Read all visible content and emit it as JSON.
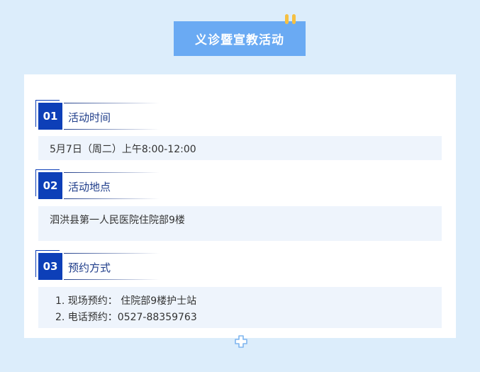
{
  "title": "义诊暨宣教活动",
  "sections": [
    {
      "num": "01",
      "label": "活动时间",
      "lines": [
        "5月7日（周二）上午8:00-12:00"
      ]
    },
    {
      "num": "02",
      "label": "活动地点",
      "lines": [
        "泗洪县第一人民医院住院部9楼"
      ]
    },
    {
      "num": "03",
      "label": "预约方式",
      "lines": [
        "1. 现场预约： 住院部9楼护士站",
        "2. 电话预约：0527-88359763"
      ]
    }
  ],
  "icons": {
    "decor_top": "binder-clip-icon",
    "decor_bottom": "plus-icon"
  },
  "colors": {
    "background": "#dcedfb",
    "title_bg": "#6aaaf3",
    "badge": "#0d3fb8",
    "label": "#1f3d8a",
    "info_bg": "#eef4fc",
    "pin": "#f5c042"
  }
}
